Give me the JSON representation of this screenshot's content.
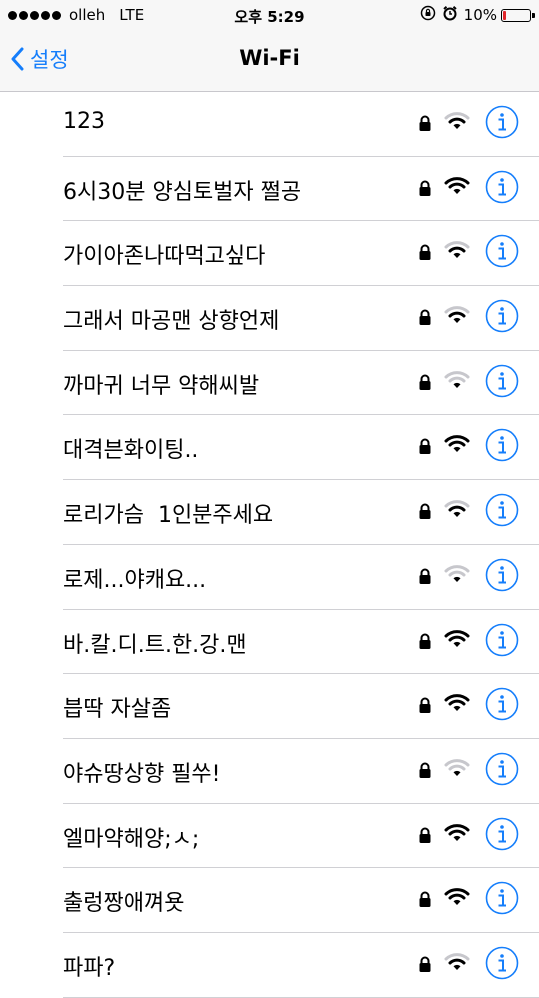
{
  "status_bar": {
    "carrier": "olleh",
    "network": "LTE",
    "time": "오후 5:29",
    "battery_percent": "10%",
    "battery_level": 0.1
  },
  "nav": {
    "back_label": "설정",
    "title": "Wi-Fi"
  },
  "colors": {
    "accent": "#157efb",
    "battery_low": "#e0262b",
    "separator": "#d0d0d4"
  },
  "networks": [
    {
      "name": "123",
      "secured": true,
      "signal": 2
    },
    {
      "name": "6시30분 양심토벌자 쩔공",
      "secured": true,
      "signal": 3
    },
    {
      "name": "가이아존나따먹고싶다",
      "secured": true,
      "signal": 2
    },
    {
      "name": "그래서 마공맨 상향언제",
      "secured": true,
      "signal": 2
    },
    {
      "name": "까마귀 너무 약해씨발",
      "secured": true,
      "signal": 1
    },
    {
      "name": "대격븐화이팅..",
      "secured": true,
      "signal": 3
    },
    {
      "name": "로리가슴  1인분주세요",
      "secured": true,
      "signal": 2
    },
    {
      "name": "로제...야캐요...",
      "secured": true,
      "signal": 1
    },
    {
      "name": "바.칼.디.트.한.강.맨",
      "secured": true,
      "signal": 3
    },
    {
      "name": "븝딱 자살좀",
      "secured": true,
      "signal": 3
    },
    {
      "name": "야슈땅상향 필쑤!",
      "secured": true,
      "signal": 1
    },
    {
      "name": "엘마약해양;ㅅ;",
      "secured": true,
      "signal": 3
    },
    {
      "name": "출렁짱애껴욧",
      "secured": true,
      "signal": 3
    },
    {
      "name": "파파?",
      "secured": true,
      "signal": 2
    }
  ]
}
